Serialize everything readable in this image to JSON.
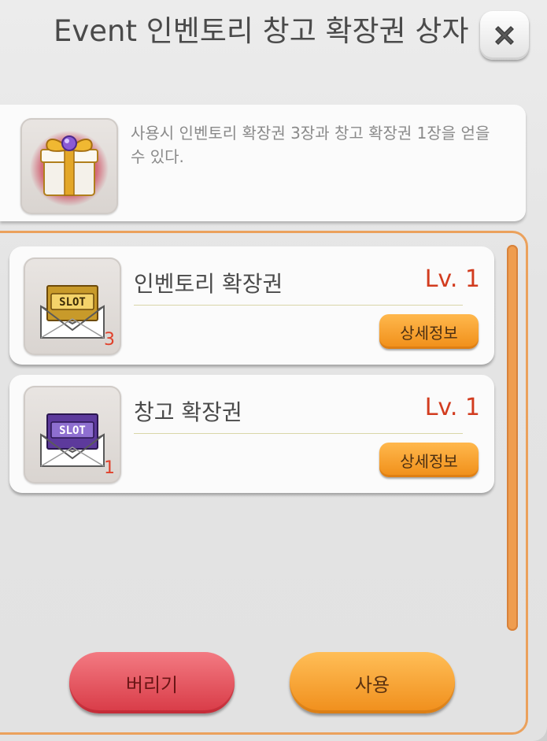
{
  "window": {
    "title": "Event 인벤토리 창고 확장권 상자",
    "close_icon": "close-x-icon"
  },
  "item": {
    "icon": "gift-box-icon",
    "description": "사용시 인벤토리 확장권 3장과 창고 확장권 1장을 얻을 수 있다."
  },
  "rewards": [
    {
      "icon": "gold-slot-ticket-icon",
      "count": "3",
      "name": "인벤토리 확장권",
      "level": "Lv. 1",
      "detail_label": "상세정보"
    },
    {
      "icon": "purple-slot-ticket-icon",
      "count": "1",
      "name": "창고 확장권",
      "level": "Lv. 1",
      "detail_label": "상세정보"
    }
  ],
  "buttons": {
    "discard": "버리기",
    "use": "사용"
  },
  "colors": {
    "accent": "#eba15c",
    "level_text": "#d23c1f",
    "discard": "#d83a46",
    "use": "#f08e1b"
  }
}
